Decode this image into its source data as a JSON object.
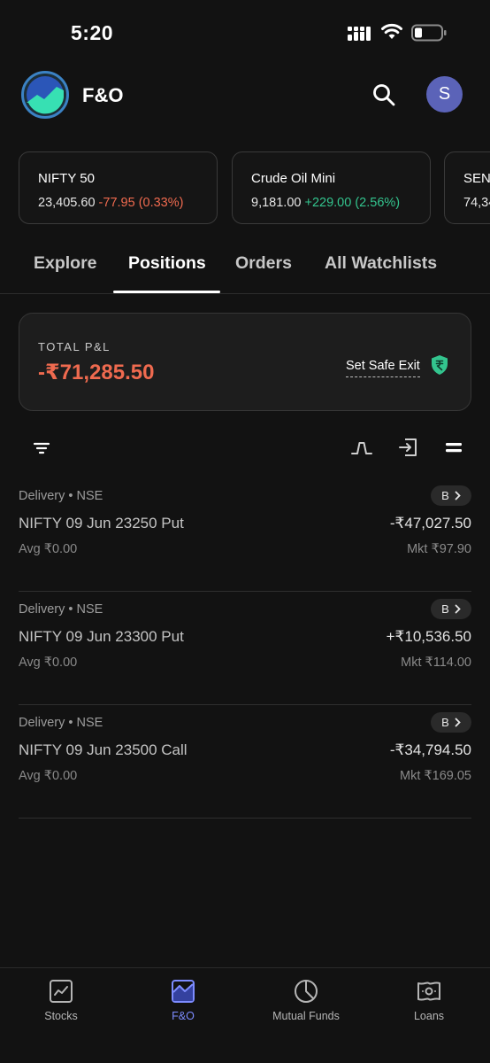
{
  "status_bar": {
    "time": "5:20"
  },
  "header": {
    "title": "F&O",
    "avatar_initial": "S"
  },
  "indices": [
    {
      "name": "NIFTY 50",
      "value": "23,405.60",
      "change": "-77.95 (0.33%)",
      "direction": "down"
    },
    {
      "name": "Crude Oil Mini",
      "value": "9,181.00",
      "change": "+229.00 (2.56%)",
      "direction": "up"
    },
    {
      "name": "SENS",
      "value": "74,34",
      "change": "",
      "direction": ""
    }
  ],
  "tabs": [
    {
      "label": "Explore"
    },
    {
      "label": "Positions",
      "active": true
    },
    {
      "label": "Orders"
    },
    {
      "label": "All Watchlists"
    }
  ],
  "pnl": {
    "label": "TOTAL P&L",
    "value": "-₹71,285.50",
    "safe_exit_label": "Set Safe Exit"
  },
  "positions": [
    {
      "meta": "Delivery • NSE",
      "badge": "B",
      "name": "NIFTY 09 Jun 23250 Put",
      "pnl": "-₹47,027.50",
      "avg": "Avg ₹0.00",
      "mkt": "Mkt ₹97.90"
    },
    {
      "meta": "Delivery • NSE",
      "badge": "B",
      "name": "NIFTY 09 Jun 23300 Put",
      "pnl": "+₹10,536.50",
      "avg": "Avg ₹0.00",
      "mkt": "Mkt ₹114.00"
    },
    {
      "meta": "Delivery • NSE",
      "badge": "B",
      "name": "NIFTY 09 Jun 23500 Call",
      "pnl": "-₹34,794.50",
      "avg": "Avg ₹0.00",
      "mkt": "Mkt ₹169.05"
    }
  ],
  "bottom_nav": [
    {
      "label": "Stocks",
      "icon": "stocks-chart-icon"
    },
    {
      "label": "F&O",
      "icon": "fno-icon",
      "active": true
    },
    {
      "label": "Mutual Funds",
      "icon": "pie-chart-icon"
    },
    {
      "label": "Loans",
      "icon": "loans-cash-icon"
    }
  ],
  "colors": {
    "negative": "#ef6a4f",
    "positive": "#33c48e",
    "accent": "#7d8cff",
    "avatar": "#5b63b8"
  }
}
